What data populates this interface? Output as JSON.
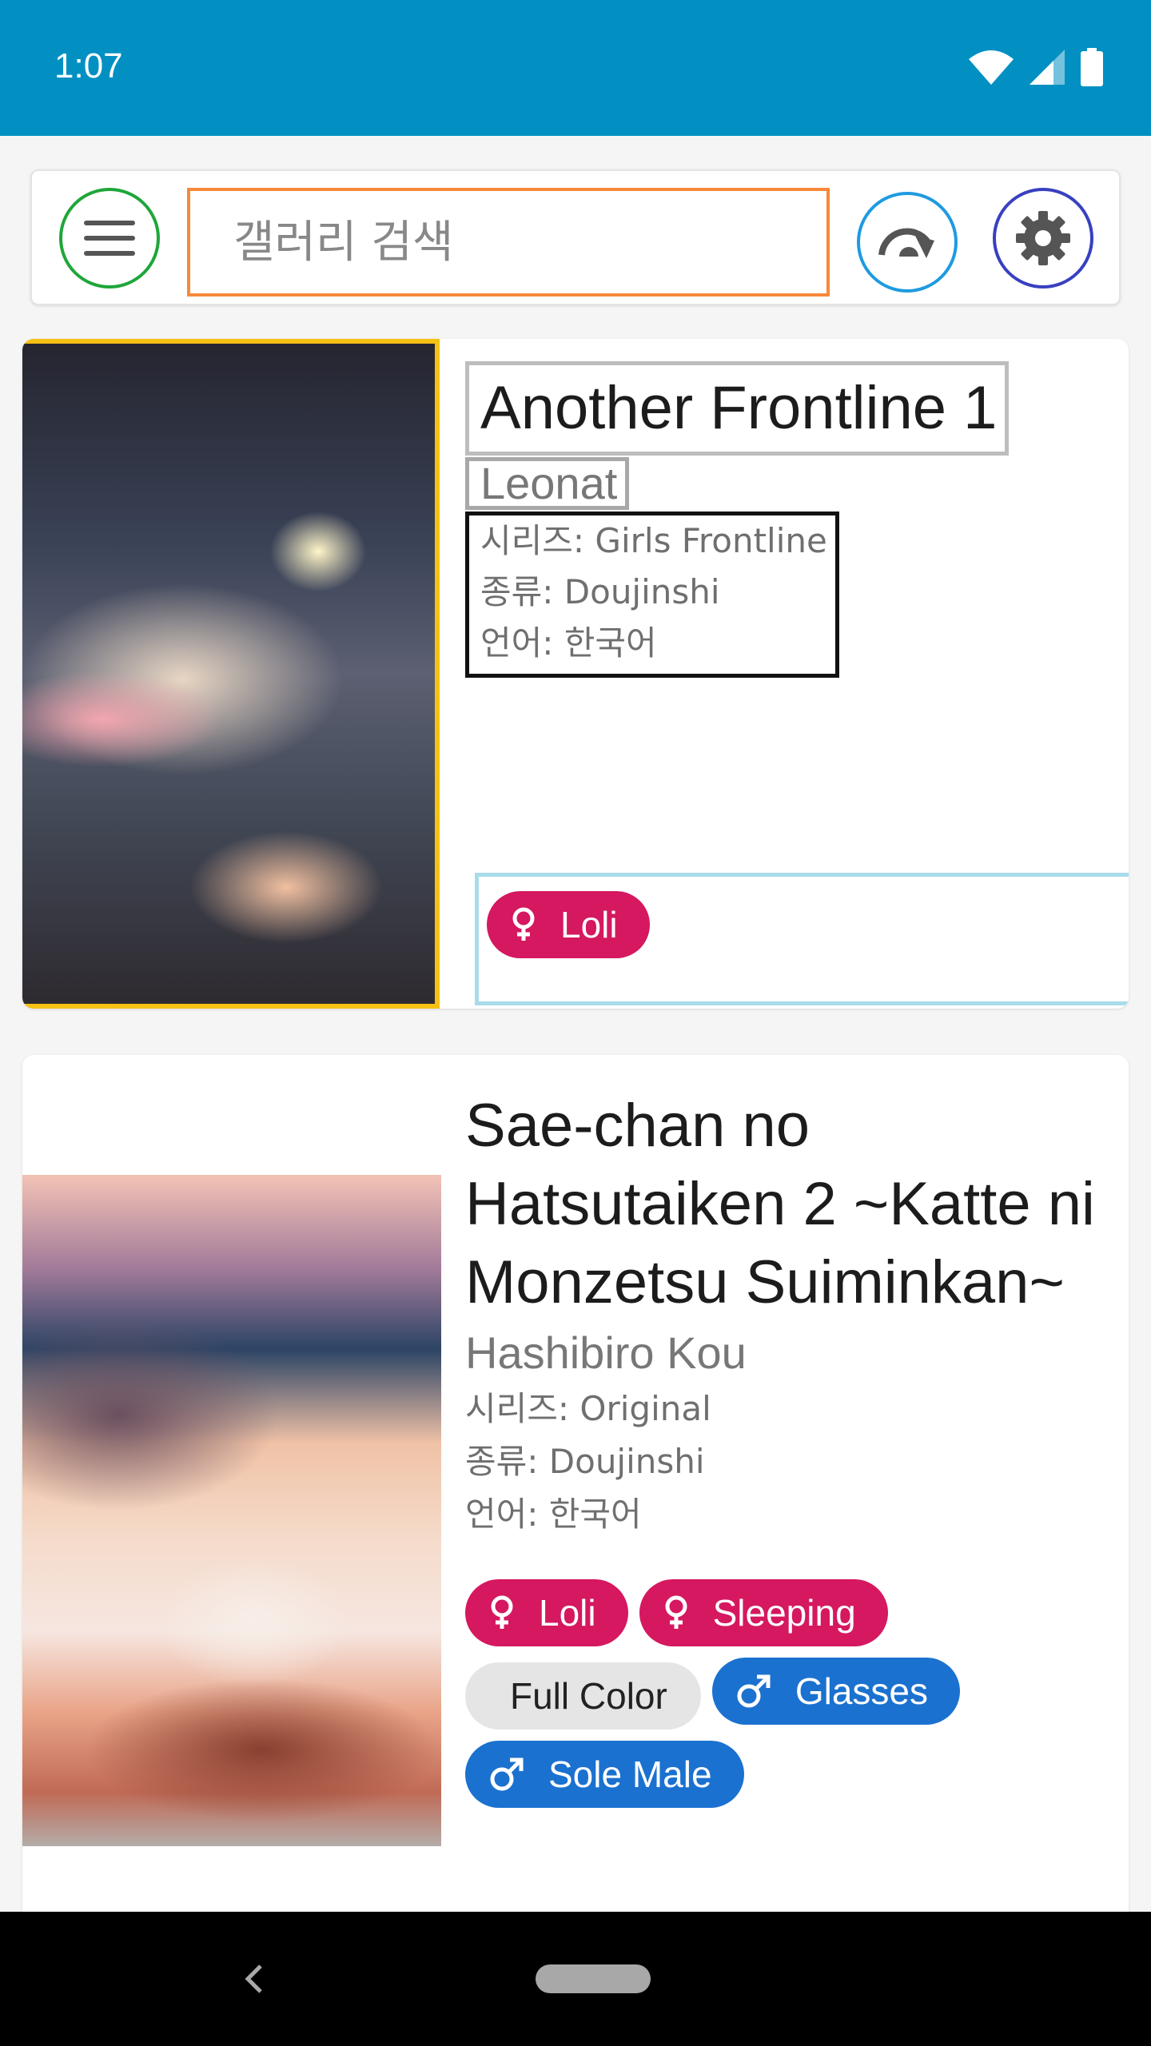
{
  "status_bar": {
    "time": "1:07",
    "icons": [
      "wifi-icon",
      "cellular-signal-icon",
      "battery-icon"
    ]
  },
  "search": {
    "placeholder": "갤러리 검색",
    "menu_icon": "hamburger-menu-icon",
    "history_icon": "redo-history-icon",
    "settings_icon": "gear-icon"
  },
  "galleries": [
    {
      "title": "Another Frontline 1",
      "artist": "Leonat",
      "series": "시리즈: Girls Frontline",
      "type": "종류: Doujinshi",
      "language": "언어: 한국어",
      "tags": [
        {
          "label": "Loli",
          "kind": "female"
        }
      ]
    },
    {
      "title": "Sae-chan no Hatsutaiken 2 ~Katte ni Monzetsu Suiminkan~",
      "artist": "Hashibiro Kou",
      "series": "시리즈: Original",
      "type": "종류: Doujinshi",
      "language": "언어: 한국어",
      "tags": [
        {
          "label": "Loli",
          "kind": "female"
        },
        {
          "label": "Sleeping",
          "kind": "female"
        },
        {
          "label": "Full Color",
          "kind": "plain"
        },
        {
          "label": "Glasses",
          "kind": "male"
        },
        {
          "label": "Sole Male",
          "kind": "male"
        }
      ]
    }
  ],
  "colors": {
    "status_bar": "#0290c3",
    "female_tag": "#d51860",
    "male_tag": "#1b71cf",
    "plain_tag": "#e5e5e5"
  }
}
